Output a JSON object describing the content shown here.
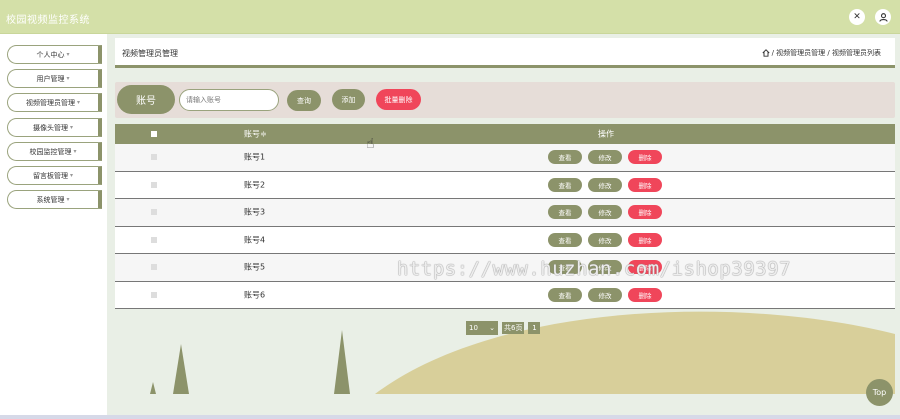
{
  "app": {
    "title": "校园视频监控系统"
  },
  "topbar": {
    "icons": [
      "fullscreen-icon",
      "user-icon"
    ]
  },
  "sidebar": {
    "items": [
      {
        "label": "个人中心"
      },
      {
        "label": "用户管理"
      },
      {
        "label": "视频管理员管理"
      },
      {
        "label": "摄像头管理"
      },
      {
        "label": "校园监控管理"
      },
      {
        "label": "留言板管理"
      },
      {
        "label": "系统管理"
      }
    ],
    "caret": "▾"
  },
  "breadcrumb": {
    "title": "视频管理员管理",
    "home_icon": "home-icon",
    "path": "/ 视频管理员管理 / 视频管理员列表"
  },
  "search": {
    "label": "账号",
    "placeholder": "请输入账号",
    "query_button": "查询",
    "add_button": "添加",
    "batch_delete_button": "批量删除"
  },
  "table": {
    "headers": {
      "name": "账号≑",
      "ops": "操作"
    },
    "rows": [
      {
        "name": "账号1"
      },
      {
        "name": "账号2"
      },
      {
        "name": "账号3"
      },
      {
        "name": "账号4"
      },
      {
        "name": "账号5"
      },
      {
        "name": "账号6"
      }
    ],
    "actions": {
      "view": "查看",
      "edit": "修改",
      "delete": "删除"
    }
  },
  "pagination": {
    "page_size": "10",
    "total_text": "共6页",
    "current_page": "1"
  },
  "watermark": "https://www.huzhan.com/ishop39397",
  "top_button": "Top",
  "colors": {
    "topbar": "#d4e0a8",
    "olive": "#8c936a",
    "danger": "#f0465a",
    "search_bg": "#e6ddd8"
  }
}
